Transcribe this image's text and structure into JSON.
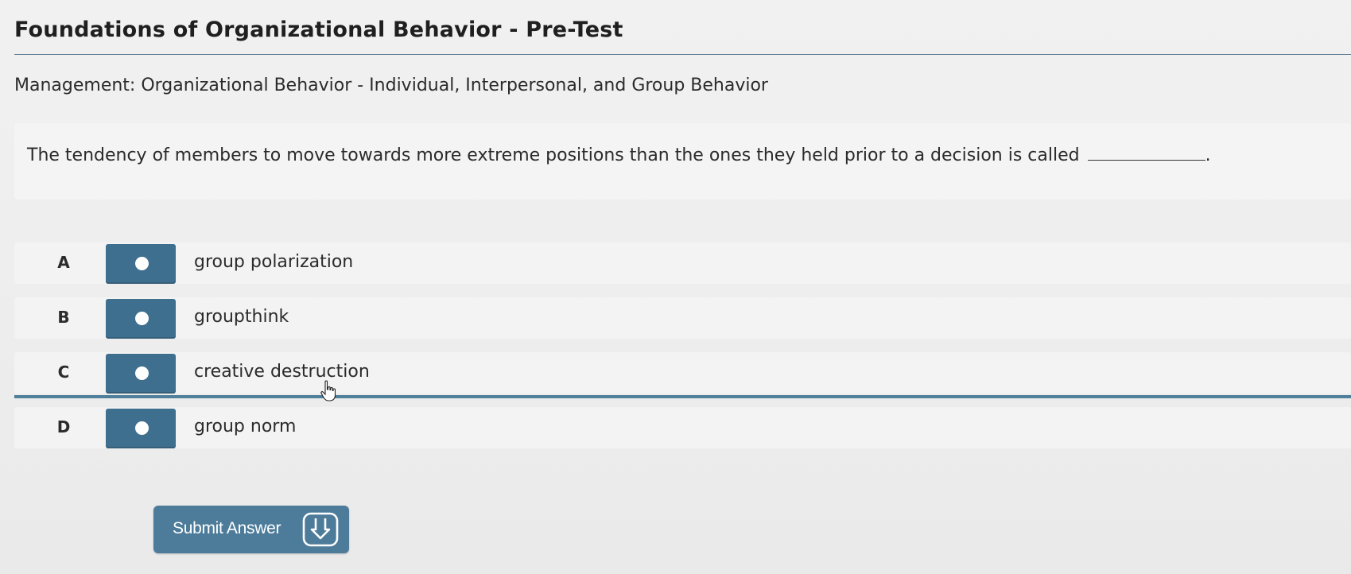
{
  "header": {
    "title": "Foundations of Organizational Behavior - Pre-Test",
    "subtitle": "Management: Organizational Behavior - Individual, Interpersonal, and Group Behavior"
  },
  "question": {
    "text": "The tendency of members to move towards more extreme positions than the ones they held prior to a decision is called",
    "end_punctuation": "."
  },
  "options": [
    {
      "letter": "A",
      "text": "group polarization"
    },
    {
      "letter": "B",
      "text": "groupthink"
    },
    {
      "letter": "C",
      "text": "creative destruction"
    },
    {
      "letter": "D",
      "text": "group norm"
    }
  ],
  "submit": {
    "label": "Submit Answer",
    "icon": "submit-arrow-icon"
  },
  "colors": {
    "accent": "#3f6f8e",
    "button": "#4d7c9b",
    "rule": "#5f7e96"
  }
}
